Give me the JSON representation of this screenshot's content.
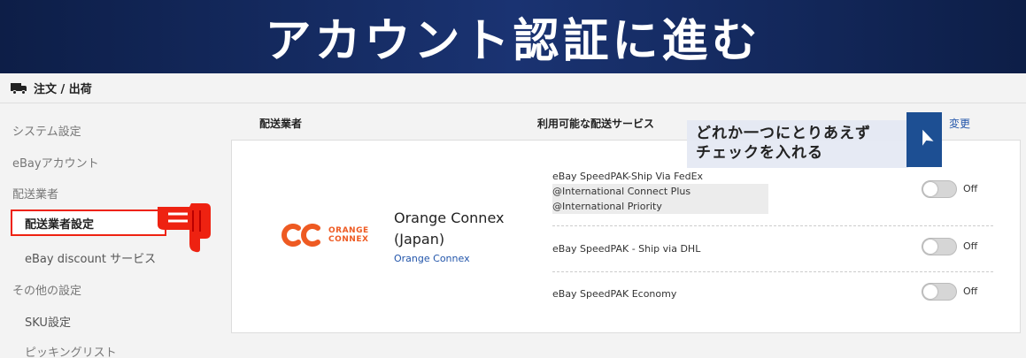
{
  "banner": {
    "title": "アカウント認証に進む"
  },
  "topbar": {
    "icon": "truck-icon",
    "title": "注文 / 出荷"
  },
  "sidebar": {
    "items": [
      {
        "label": "システム設定"
      },
      {
        "label": "eBayアカウント"
      },
      {
        "label": "配送業者"
      },
      {
        "label": "配送業者設定",
        "active": true
      },
      {
        "label": "eBay discount サービス"
      },
      {
        "label": "その他の設定"
      },
      {
        "label": "SKU設定"
      },
      {
        "label": "ピッキングリスト"
      }
    ]
  },
  "main": {
    "header": {
      "carrier_col": "配送業者",
      "services_col": "利用可能な配送サービス",
      "change_link": "変更"
    },
    "carrier": {
      "logo_line1": "ORANGE",
      "logo_line2": "CONNEX",
      "name": "Orange Connex (Japan)",
      "link": "Orange Connex"
    },
    "services": [
      {
        "lines": [
          "eBay SpeedPAK-Ship Via FedEx",
          "@International Connect Plus",
          "@International Priority"
        ],
        "toggle": "Off"
      },
      {
        "lines": [
          "eBay SpeedPAK - Ship via DHL"
        ],
        "toggle": "Off"
      },
      {
        "lines": [
          "eBay SpeedPAK Economy"
        ],
        "toggle": "Off"
      }
    ]
  },
  "callout": {
    "line1": "どれか一つにとりあえず",
    "line2": "チェックを入れる"
  },
  "colors": {
    "banner": "#0d1e47",
    "accent_red": "#e21",
    "link": "#2255aa",
    "logo": "#ee5a22"
  }
}
